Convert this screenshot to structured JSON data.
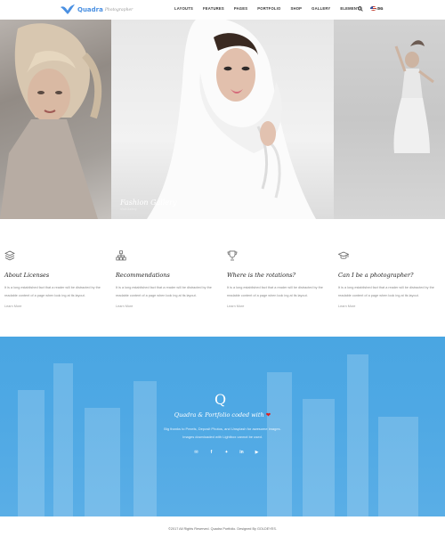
{
  "header": {
    "brand": "Quadra",
    "brand_sub": "Photographer",
    "nav": [
      "LAYOUTS",
      "FEATURES",
      "PAGES",
      "PORTFOLIO",
      "SHOP",
      "GALLERY",
      "ELEMENTS",
      "BLOG"
    ],
    "language": "En"
  },
  "hero": {
    "caption_title": "Fashion Gallery",
    "caption_sub": "Visit Gallery"
  },
  "features": [
    {
      "icon": "layers-icon",
      "title": "About Licenses",
      "text": "It is a long established fact that a reader will be distracted by the readable content of a page when look ing at its layout.",
      "link": "Learn More"
    },
    {
      "icon": "sitemap-icon",
      "title": "Recommendations",
      "text": "It is a long established fact that a reader will be distracted by the readable content of a page when look ing at its layout.",
      "link": "Learn More"
    },
    {
      "icon": "trophy-icon",
      "title": "Where is the rotations?",
      "text": "It is a long established fact that a reader will be distracted by the readable content of a page when look ing at its layout.",
      "link": "Learn More"
    },
    {
      "icon": "graduation-cap-icon",
      "title": "Can I be a photographer?",
      "text": "It is a long established fact that a reader will be distracted by the readable content of a page when look ing at its layout.",
      "link": "Learn More"
    }
  ],
  "footer_blue": {
    "mark": "Q",
    "title": "Quadra & Portfolio coded with",
    "line1": "Big thanks to Pexels, Deposit Photos, and Unsplash for awesome images.",
    "line2": "Images downloaded with Lightbox cannot be used.",
    "socials": [
      "email-icon",
      "facebook-icon",
      "twitter-icon",
      "linkedin-icon",
      "youtube-icon"
    ]
  },
  "copyright": "©2017 All Rights Reserved. Quadra Portfolio. Designed By GOLDEYES.",
  "colors": {
    "accent": "#4a90e2",
    "blue_section": "#4ea8e4",
    "heart": "#e02020"
  }
}
